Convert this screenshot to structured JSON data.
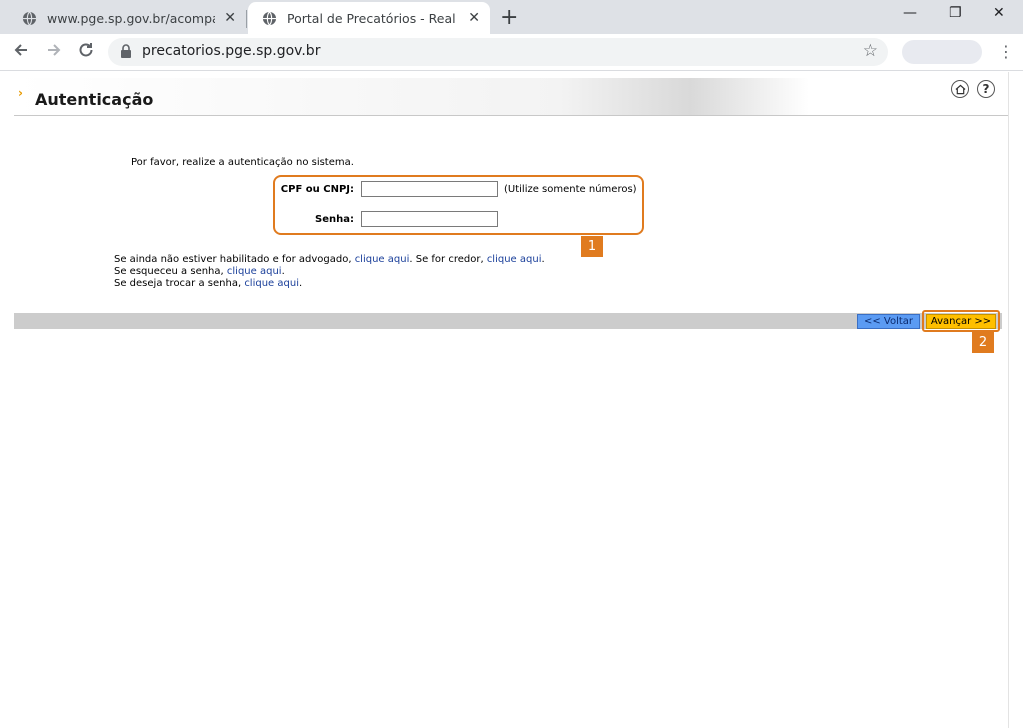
{
  "browser": {
    "tabs": [
      {
        "title": "www.pge.sp.gov.br/acompanhe/p",
        "active": false
      },
      {
        "title": "Portal de Precatórios - Realize a a",
        "active": true
      }
    ],
    "url": "precatorios.pge.sp.gov.br",
    "new_tab_glyph": "+",
    "close_glyph": "✕",
    "window_controls": [
      "—",
      "❐",
      "✕"
    ]
  },
  "page": {
    "title": "Autenticação",
    "intro": "Por favor, realize a autenticação no sistema.",
    "form": {
      "cpf_label": "CPF ou CNPJ:",
      "cpf_value": "",
      "cpf_hint": "(Utilize somente números)",
      "senha_label": "Senha:",
      "senha_value": ""
    },
    "help": {
      "line1_prefix": "Se ainda não estiver habilitado e for advogado,",
      "line1_link1": "clique aqui",
      "line1_middle": ". Se for credor,",
      "line1_link2": "clique aqui",
      "line1_suffix": ".",
      "line2_prefix": "Se esqueceu a senha,",
      "line2_link": "clique aqui",
      "line2_suffix": ".",
      "line3_prefix": "Se deseja trocar a senha,",
      "line3_link": "clique aqui",
      "line3_suffix": "."
    },
    "buttons": {
      "back": "<< Voltar",
      "next": "Avançar >>"
    },
    "header_icons": [
      "home-icon",
      "help-icon"
    ],
    "help_icon_glyph": "?"
  },
  "annotations": {
    "badge1": "1",
    "badge2": "2",
    "accent": "#e07b1f"
  }
}
